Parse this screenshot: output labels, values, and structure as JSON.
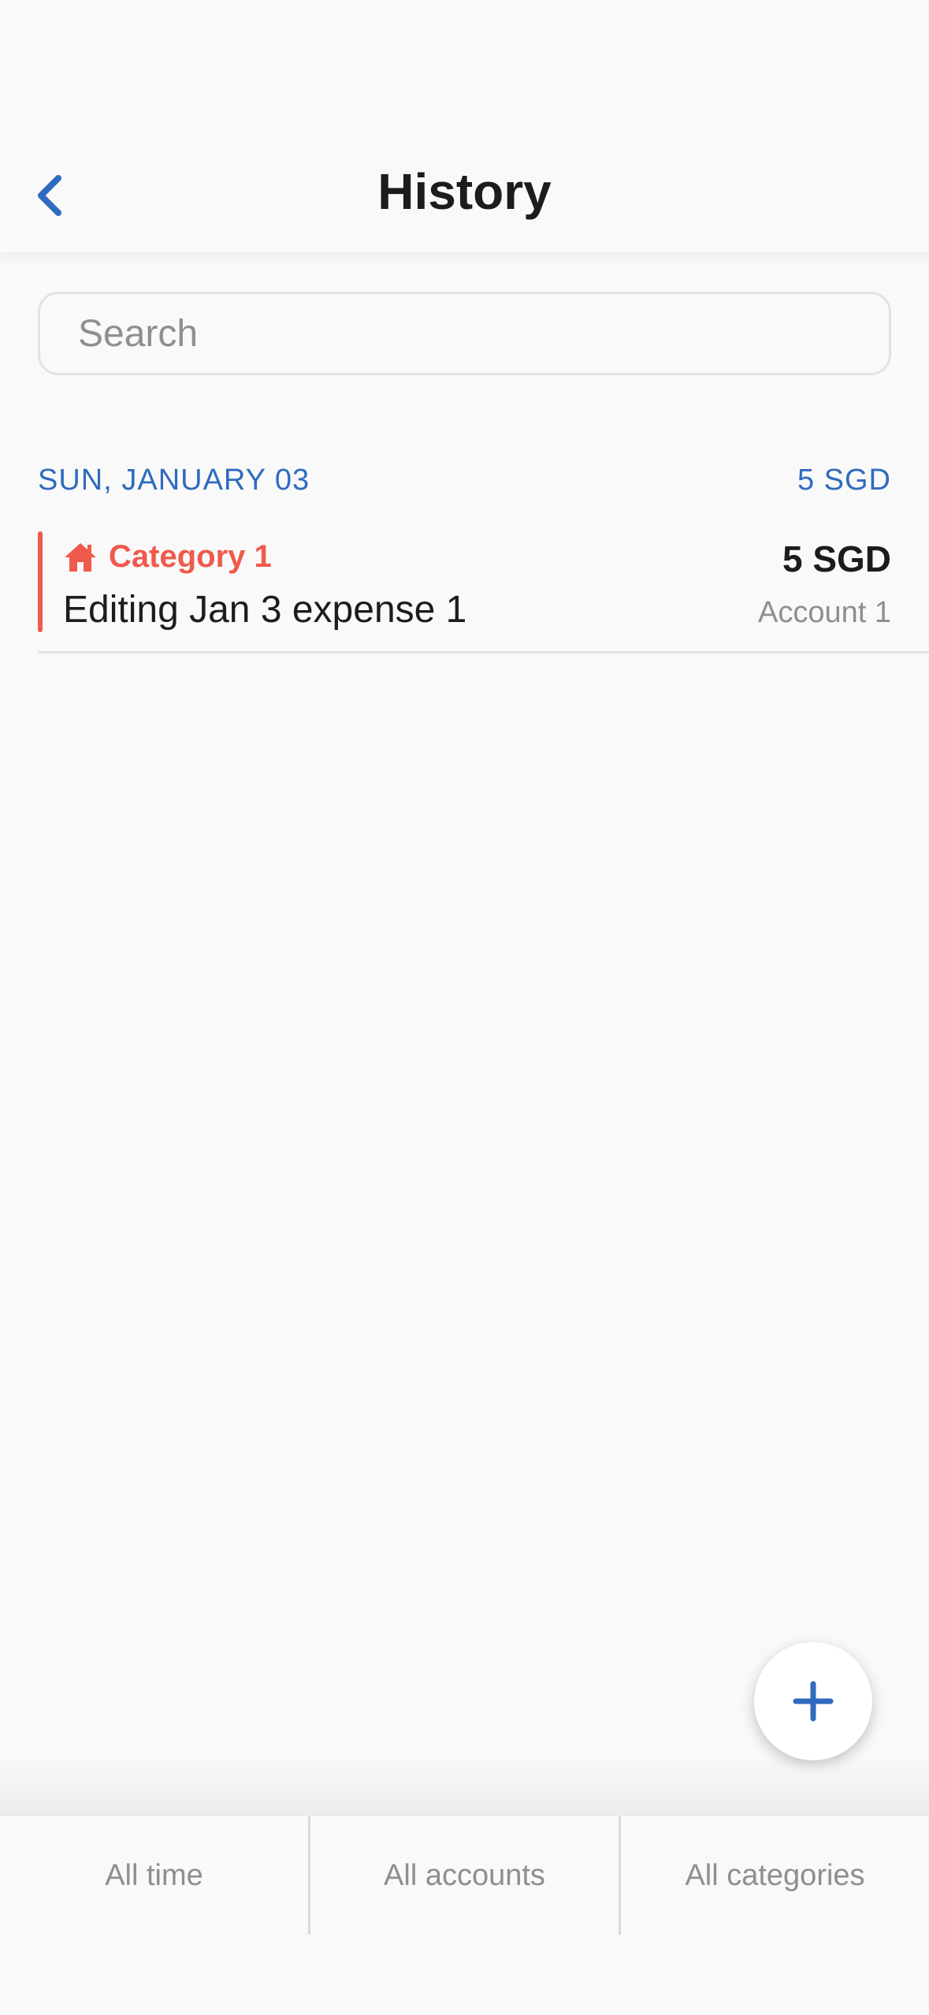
{
  "header": {
    "title": "History",
    "back_icon": "chevron-left-icon"
  },
  "search": {
    "placeholder": "Search",
    "value": ""
  },
  "groups": [
    {
      "date": "SUN, JANUARY 03",
      "total": "5 SGD",
      "transactions": [
        {
          "category": "Category 1",
          "category_icon": "home-icon",
          "note": "Editing Jan 3 expense 1",
          "amount": "5 SGD",
          "account": "Account 1"
        }
      ]
    }
  ],
  "fab": {
    "icon": "plus-icon"
  },
  "filters": {
    "time": "All time",
    "accounts": "All accounts",
    "categories": "All categories"
  },
  "colors": {
    "accent": "#2f6bbf",
    "category": "#ef5a4c",
    "background": "#f9f9f9",
    "secondary_text": "#8e8e93"
  }
}
